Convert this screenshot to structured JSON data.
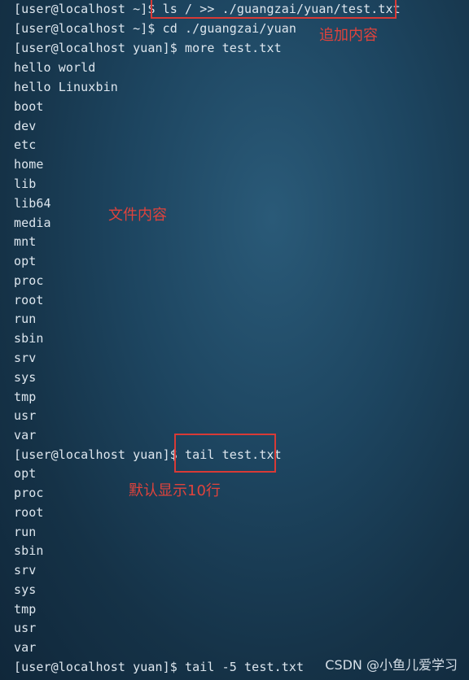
{
  "terminal": {
    "lines": [
      "[user@localhost ~]$ ls / >> ./guangzai/yuan/test.txt",
      "[user@localhost ~]$ cd ./guangzai/yuan",
      "[user@localhost yuan]$ more test.txt",
      "hello world",
      "hello Linuxbin",
      "boot",
      "dev",
      "etc",
      "home",
      "lib",
      "lib64",
      "media",
      "mnt",
      "opt",
      "proc",
      "root",
      "run",
      "sbin",
      "srv",
      "sys",
      "tmp",
      "usr",
      "var",
      "[user@localhost yuan]$ tail test.txt",
      "opt",
      "proc",
      "root",
      "run",
      "sbin",
      "srv",
      "sys",
      "tmp",
      "usr",
      "var",
      "[user@localhost yuan]$ tail -5 test.txt"
    ]
  },
  "annotations": {
    "append_content": "追加内容",
    "file_content": "文件内容",
    "default_ten_lines": "默认显示10行"
  },
  "colors": {
    "annotation": "#e0433c",
    "box_border": "#d83a36",
    "terminal_text": "#dde6ee",
    "background": "#1d4560"
  },
  "watermark": "CSDN @小鱼儿爱学习"
}
